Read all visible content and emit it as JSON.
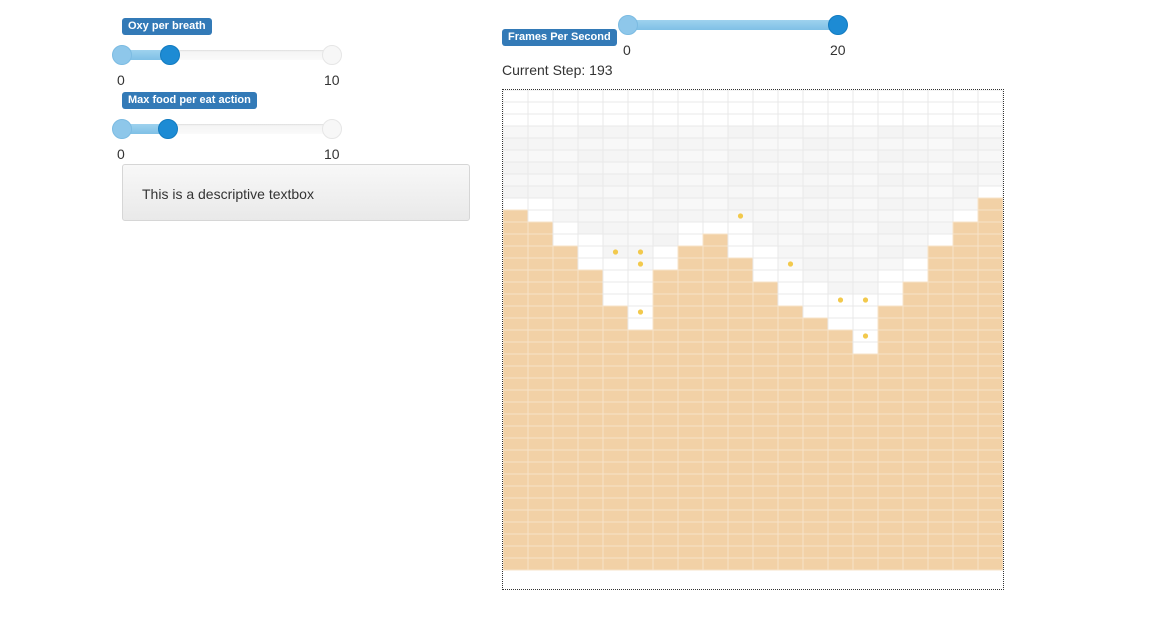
{
  "sliders": {
    "oxy": {
      "label": "Oxy per breath",
      "min": "0",
      "max": "10",
      "value": 2
    },
    "food": {
      "label": "Max food per eat action",
      "min": "0",
      "max": "10",
      "value": 2
    },
    "fps": {
      "label": "Frames Per Second",
      "min": "0",
      "max": "20",
      "value": 20
    }
  },
  "textbox": {
    "text": "This is a descriptive textbox"
  },
  "step": {
    "label": "Current Step:",
    "value": "193"
  },
  "colors": {
    "badge": "#337ab7",
    "soil": "#f2d1a6",
    "air": "#ffffff",
    "agent": "#f2c94c",
    "slider_active": "#1d8bd4"
  }
}
